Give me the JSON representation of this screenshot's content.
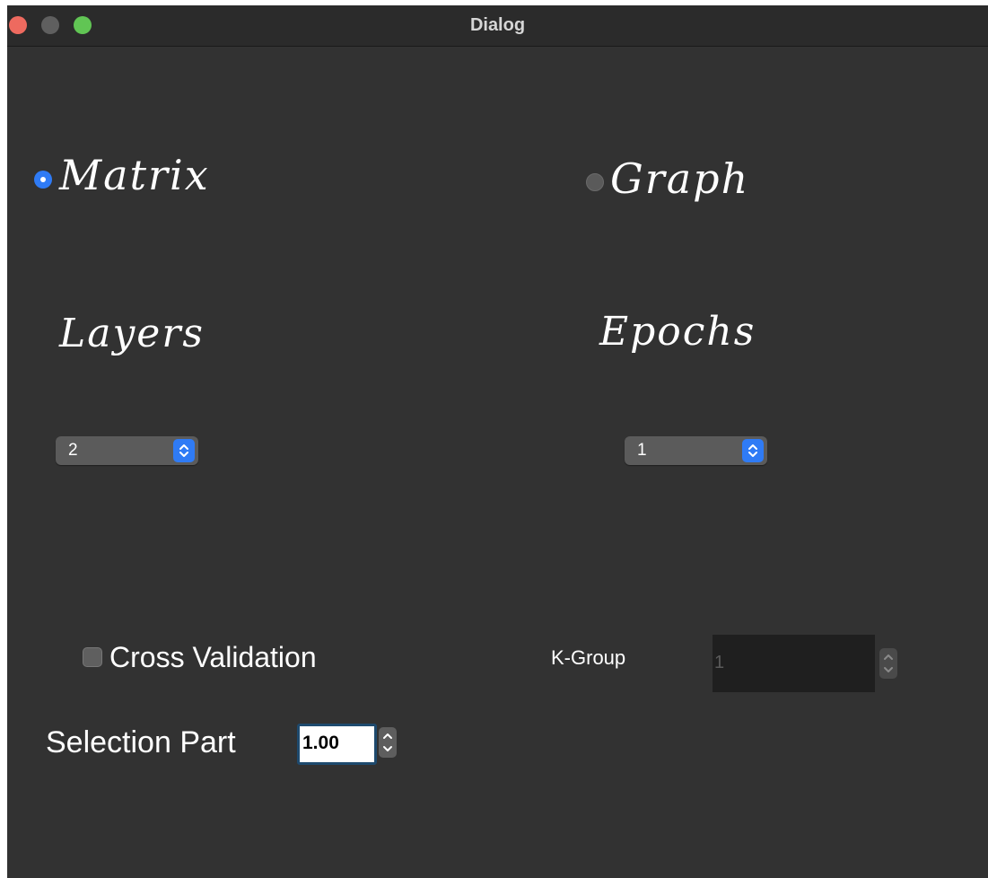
{
  "window": {
    "title": "Dialog"
  },
  "mode": {
    "matrix_label": "Matrix",
    "matrix_selected": true,
    "graph_label": "Graph",
    "graph_selected": false
  },
  "layers": {
    "label": "Layers",
    "value": "2"
  },
  "epochs": {
    "label": "Epochs",
    "value": "1"
  },
  "cross_validation": {
    "label": "Cross Validation",
    "checked": false
  },
  "k_group": {
    "label": "K-Group",
    "value": "1",
    "enabled": false
  },
  "selection_part": {
    "label": "Selection Part",
    "value": "1.00"
  },
  "colors": {
    "background": "#323232",
    "accent": "#2f7bf5",
    "focus_ring": "#1e4a6e"
  }
}
